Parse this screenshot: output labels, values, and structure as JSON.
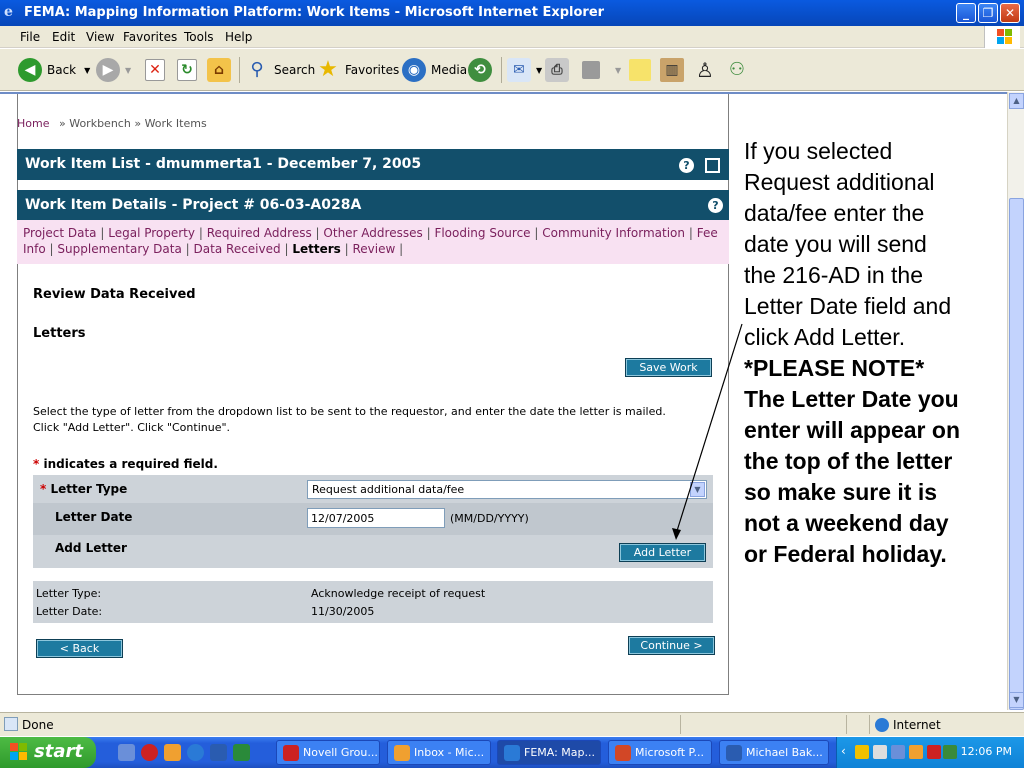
{
  "window": {
    "title": "FEMA: Mapping Information Platform: Work Items - Microsoft Internet Explorer",
    "min": "_",
    "max": "❐",
    "close": "✕"
  },
  "menu": [
    "File",
    "Edit",
    "View",
    "Favorites",
    "Tools",
    "Help"
  ],
  "toolbar": {
    "back": "Back",
    "search": "Search",
    "favorites": "Favorites",
    "media": "Media"
  },
  "breadcrumb": {
    "home": "Home",
    "sep1": "»",
    "workbench": "Workbench",
    "sep2": "»",
    "current": "Work Items"
  },
  "work_item_list": {
    "title": "Work Item List - dmummerta1 - December 7, 2005"
  },
  "details": {
    "title": "Work Item Details - Project # 06-03-A028A",
    "help": "?"
  },
  "tabs": {
    "project_data": "Project Data",
    "legal_property": "Legal Property",
    "required_address": "Required Address",
    "other_addresses": "Other Addresses",
    "flooding_source": "Flooding Source",
    "community_information": "Community Information",
    "fee": "Fee",
    "info": "Info",
    "supplementary_data": "Supplementary Data",
    "data_received": "Data Received",
    "letters": "Letters",
    "review": "Review",
    "sep": "|"
  },
  "content": {
    "section_title": "Review Data Received",
    "sub_title": "Letters",
    "save_work": "Save Work",
    "instruction_1": "Select the type of letter from the dropdown list to be sent to the requestor, and enter the date the letter is mailed.",
    "instruction_2": "Click \"Add Letter\". Click \"Continue\".",
    "required_star": "*",
    "required_note": "indicates a required field."
  },
  "form": {
    "letter_type_label": "Letter Type",
    "letter_type_value": "Request additional data/fee",
    "letter_date_label": "Letter Date",
    "letter_date_value": "12/07/2005",
    "letter_date_hint": "(MM/DD/YYYY)",
    "add_letter_label": "Add Letter",
    "add_letter_button": "Add Letter"
  },
  "summary": {
    "type_key": "Letter Type:",
    "type_value": "Acknowledge receipt of request",
    "date_key": "Letter Date:",
    "date_value": "11/30/2005"
  },
  "nav": {
    "back": "< Back",
    "continue": "Continue >"
  },
  "annotation": {
    "line1": "If you selected",
    "line2": "Request additional",
    "line3": "data/fee enter the",
    "line4": "date you will send",
    "line5": "the 216-AD in the",
    "line6": "Letter Date field and",
    "line7": "click Add Letter.",
    "b1": "*PLEASE NOTE*",
    "b2": "The Letter Date you",
    "b3": "enter will appear on",
    "b4": "the top of the letter",
    "b5": "so make sure it is",
    "b6": "not a weekend day",
    "b7": "or Federal holiday."
  },
  "status": {
    "text": "Done",
    "zone": "Internet"
  },
  "taskbar": {
    "start": "start",
    "tasks": [
      "Novell Grou...",
      "Inbox - Mic...",
      "FEMA: Map...",
      "Microsoft P...",
      "Michael Bak..."
    ],
    "clock": "12:06 PM"
  }
}
